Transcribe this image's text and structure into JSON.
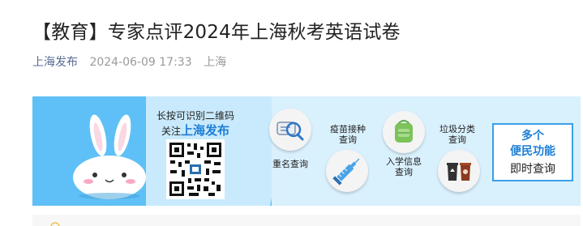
{
  "article": {
    "title": "【教育】专家点评2024年上海秋考英语试卷",
    "account": "上海发布",
    "date": "2024-06-09 17:33",
    "location": "上海"
  },
  "banner": {
    "qr_caption_line1": "长按可识别二维码",
    "qr_caption_prefix": "关注",
    "qr_caption_account": "上海发布",
    "services": [
      {
        "label": "重名查询",
        "icon": "name-search-icon"
      },
      {
        "label": "疫苗接种\n查询",
        "icon": "vaccine-syringe-icon"
      },
      {
        "label": "入学信息\n查询",
        "icon": "school-backpack-icon"
      },
      {
        "label": "垃圾分类\n查询",
        "icon": "trash-bins-icon"
      }
    ],
    "promo_line1": "多个",
    "promo_line2": "便民功能",
    "promo_line3": "即时查询"
  },
  "colors": {
    "account_link": "#576b95",
    "banner_blue": "#5ec0f6",
    "accent": "#1e7fd6"
  }
}
